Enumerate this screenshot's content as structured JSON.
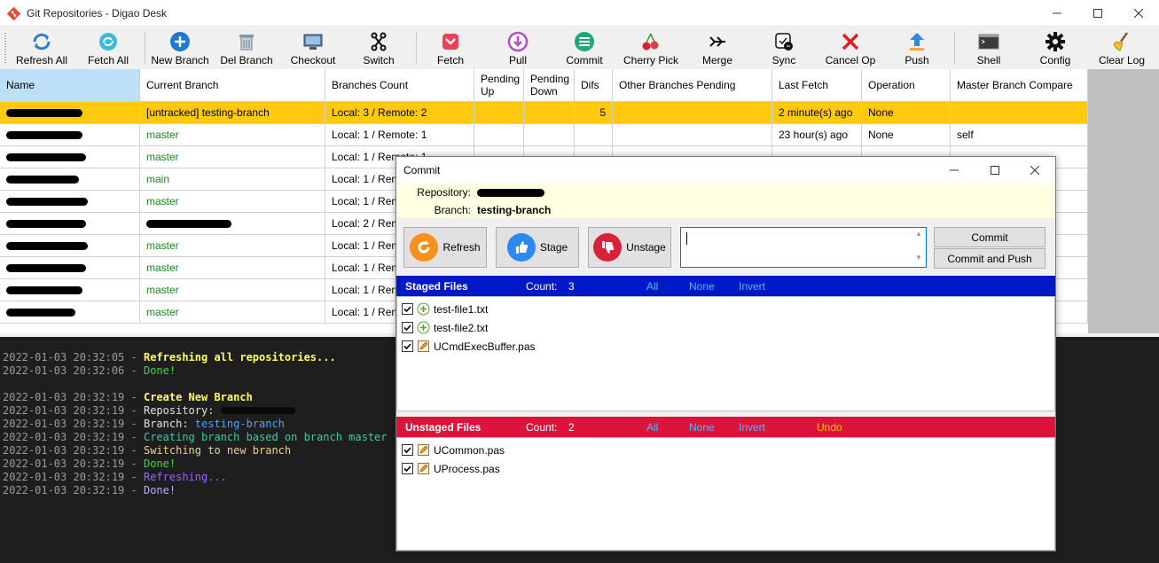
{
  "window": {
    "title": "Git Repositories - Digao Desk"
  },
  "toolbar": {
    "buttons": [
      {
        "label": "Refresh All",
        "icon": "refresh-all-icon"
      },
      {
        "label": "Fetch All",
        "icon": "fetch-all-icon"
      },
      {
        "label": "New Branch",
        "icon": "new-branch-icon"
      },
      {
        "label": "Del Branch",
        "icon": "trash-icon"
      },
      {
        "label": "Checkout",
        "icon": "checkout-icon"
      },
      {
        "label": "Switch",
        "icon": "switch-icon"
      },
      {
        "label": "Fetch",
        "icon": "fetch-icon"
      },
      {
        "label": "Pull",
        "icon": "pull-icon"
      },
      {
        "label": "Commit",
        "icon": "commit-icon"
      },
      {
        "label": "Cherry Pick",
        "icon": "cherry-icon"
      },
      {
        "label": "Merge",
        "icon": "merge-icon"
      },
      {
        "label": "Sync",
        "icon": "sync-icon"
      },
      {
        "label": "Cancel Op",
        "icon": "cancel-icon"
      },
      {
        "label": "Push",
        "icon": "push-icon"
      },
      {
        "label": "Shell",
        "icon": "shell-icon"
      },
      {
        "label": "Config",
        "icon": "gear-icon"
      },
      {
        "label": "Clear Log",
        "icon": "broom-icon"
      }
    ]
  },
  "grid": {
    "columns": [
      "Name",
      "Current Branch",
      "Branches Count",
      "Pending Up",
      "Pending Down",
      "Difs",
      "Other Branches Pending",
      "Last Fetch",
      "Operation",
      "Master Branch Compare"
    ],
    "rows": [
      {
        "branch": "[untracked] testing-branch",
        "count": "Local: 3 / Remote: 2",
        "up": "",
        "down": "",
        "difs": "5",
        "other": "",
        "fetch": "2 minute(s) ago",
        "op": "None",
        "compare": ""
      },
      {
        "branch": "master",
        "count": "Local: 1 / Remote: 1",
        "up": "",
        "down": "",
        "difs": "",
        "other": "",
        "fetch": "23 hour(s) ago",
        "op": "None",
        "compare": "self"
      },
      {
        "branch": "master",
        "count": "Local: 1 / Remote: 1",
        "up": "",
        "down": "",
        "difs": "",
        "other": "",
        "fetch": "",
        "op": "",
        "compare": ""
      },
      {
        "branch": "main",
        "count": "Local: 1 / Rem",
        "up": "",
        "down": "",
        "difs": "",
        "other": "",
        "fetch": "",
        "op": "",
        "compare": ""
      },
      {
        "branch": "master",
        "count": "Local: 1 / Rem",
        "up": "",
        "down": "",
        "difs": "",
        "other": "",
        "fetch": "",
        "op": "",
        "compare": ""
      },
      {
        "branch": "",
        "count": "Local: 2 / Rem",
        "up": "",
        "down": "",
        "difs": "",
        "other": "",
        "fetch": "",
        "op": "",
        "compare": ""
      },
      {
        "branch": "master",
        "count": "Local: 1 / Rem",
        "up": "",
        "down": "",
        "difs": "",
        "other": "",
        "fetch": "",
        "op": "",
        "compare": ""
      },
      {
        "branch": "master",
        "count": "Local: 1 / Rem",
        "up": "",
        "down": "",
        "difs": "",
        "other": "",
        "fetch": "",
        "op": "",
        "compare": ""
      },
      {
        "branch": "master",
        "count": "Local: 1 / Rem",
        "up": "",
        "down": "",
        "difs": "",
        "other": "",
        "fetch": "",
        "op": "",
        "compare": ""
      },
      {
        "branch": "master",
        "count": "Local: 1 / Rem",
        "up": "",
        "down": "",
        "difs": "",
        "other": "",
        "fetch": "",
        "op": "",
        "compare": ""
      }
    ]
  },
  "log": [
    {
      "ts": "2022-01-03 20:32:05",
      "sep": " - ",
      "text": "Refreshing all repositories...",
      "cls": "c-yellow"
    },
    {
      "ts": "2022-01-03 20:32:06",
      "sep": " - ",
      "text": "Done!",
      "cls": "c-green"
    },
    {
      "ts": "",
      "sep": "",
      "text": "",
      "cls": ""
    },
    {
      "ts": "2022-01-03 20:32:19",
      "sep": " - ",
      "text": "Create New Branch",
      "cls": "c-yellow"
    },
    {
      "ts": "2022-01-03 20:32:19",
      "sep": " - ",
      "text": "Repository: ",
      "cls": "c-white"
    },
    {
      "ts": "2022-01-03 20:32:19",
      "sep": " - ",
      "text": "Branch: ",
      "cls": "c-white",
      "extra": "testing-branch",
      "extraCls": "c-blue"
    },
    {
      "ts": "2022-01-03 20:32:19",
      "sep": " - ",
      "text": "Creating branch based on branch master",
      "cls": "c-teal"
    },
    {
      "ts": "2022-01-03 20:32:19",
      "sep": " - ",
      "text": "Switching to new branch",
      "cls": "c-khaki"
    },
    {
      "ts": "2022-01-03 20:32:19",
      "sep": " - ",
      "text": "Done!",
      "cls": "c-green"
    },
    {
      "ts": "2022-01-03 20:32:19",
      "sep": " - ",
      "text": "Refreshing...",
      "cls": "c-purple"
    },
    {
      "ts": "2022-01-03 20:32:19",
      "sep": " - ",
      "text": "Done!",
      "cls": "c-lav"
    }
  ],
  "dialog": {
    "title": "Commit",
    "repo_label": "Repository:",
    "branch_label": "Branch:",
    "branch_value": "testing-branch",
    "refresh_label": "Refresh",
    "stage_label": "Stage",
    "unstage_label": "Unstage",
    "message_value": "",
    "commit_label": "Commit",
    "commit_push_label": "Commit and Push",
    "staged": {
      "title": "Staged Files",
      "count_label": "Count:",
      "count": "3",
      "all": "All",
      "none": "None",
      "invert": "Invert",
      "files": [
        {
          "name": "test-file1.txt",
          "icon": "plus-icon"
        },
        {
          "name": "test-file2.txt",
          "icon": "plus-icon"
        },
        {
          "name": "UCmdExecBuffer.pas",
          "icon": "edit-icon"
        }
      ]
    },
    "unstaged": {
      "title": "Unstaged Files",
      "count_label": "Count:",
      "count": "2",
      "all": "All",
      "none": "None",
      "invert": "Invert",
      "undo": "Undo",
      "files": [
        {
          "name": "UCommon.pas",
          "icon": "edit-icon"
        },
        {
          "name": "UProcess.pas",
          "icon": "edit-icon"
        }
      ]
    }
  }
}
